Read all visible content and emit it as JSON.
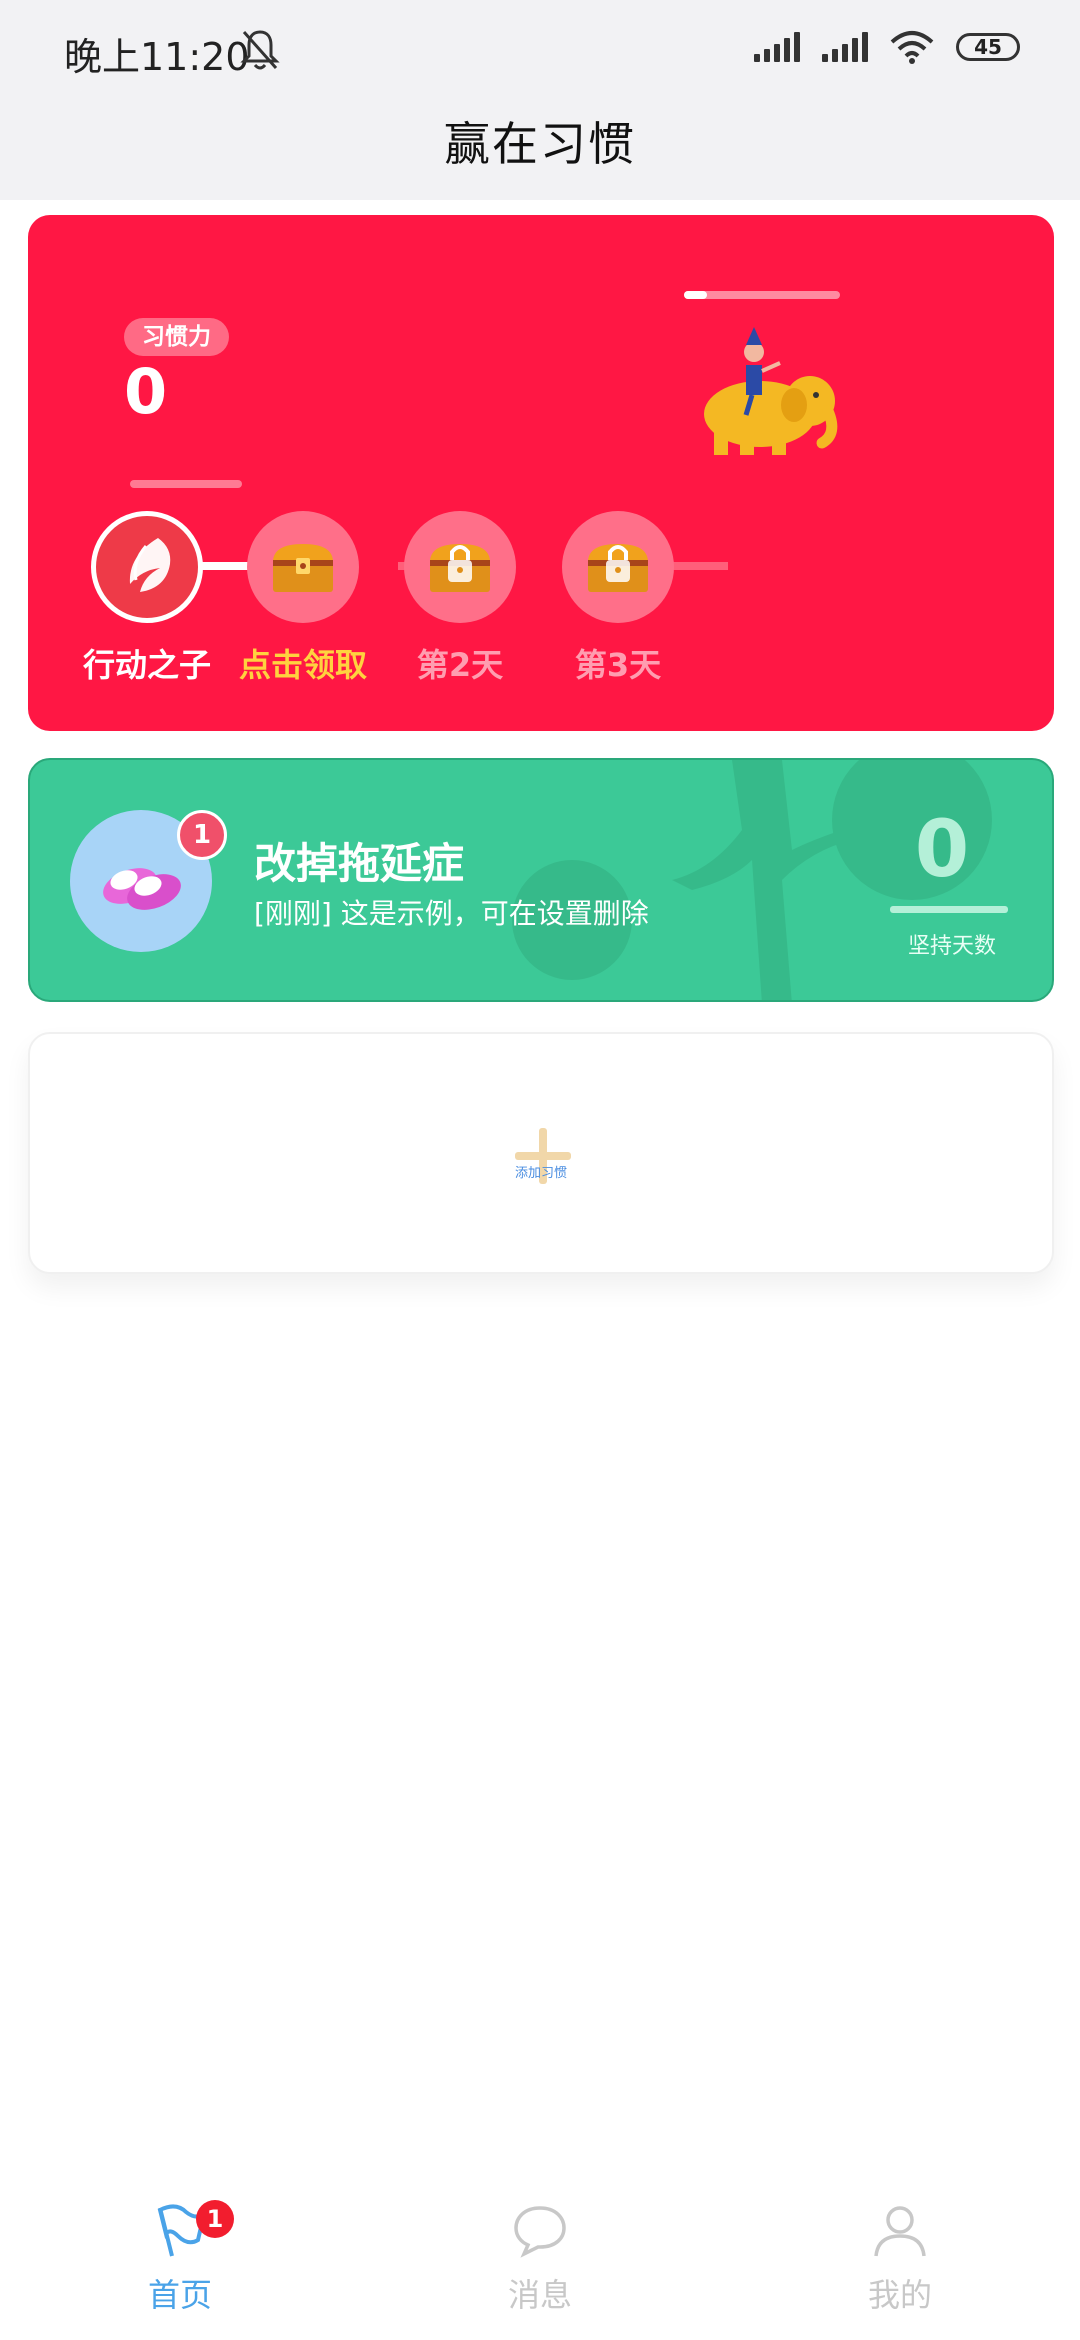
{
  "status_bar": {
    "time": "晚上11:20",
    "battery": "45"
  },
  "app": {
    "title": "赢在习惯"
  },
  "habit_card": {
    "badge": "习惯力",
    "value": "0",
    "progress": 0.15,
    "milestones": [
      {
        "label": "行动之子",
        "state": "unlocked"
      },
      {
        "label": "点击领取",
        "state": "claimable"
      },
      {
        "label": "第2天",
        "state": "locked"
      },
      {
        "label": "第3天",
        "state": "locked"
      }
    ]
  },
  "habit_item": {
    "badge_count": "1",
    "title": "改掉拖延症",
    "subtitle": "[刚刚] 这是示例，可在设置删除",
    "streak_value": "0",
    "streak_label": "坚持天数"
  },
  "add_card": {
    "label": "添加习惯"
  },
  "bottom_nav": {
    "items": [
      {
        "label": "首页",
        "icon": "flag-icon",
        "active": true,
        "badge": "1"
      },
      {
        "label": "消息",
        "icon": "chat-bubble-icon",
        "active": false
      },
      {
        "label": "我的",
        "icon": "user-icon",
        "active": false
      }
    ]
  },
  "colors": {
    "red_card": "#ff1744",
    "green_card": "#3cc997",
    "accent_blue": "#4aa3e8"
  }
}
